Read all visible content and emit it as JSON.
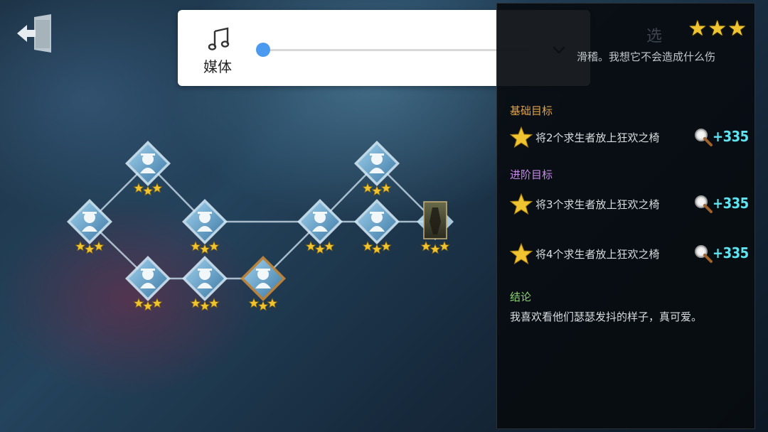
{
  "volume": {
    "label": "媒体",
    "level": 0.0,
    "music_icon": "music-note-icon",
    "expand_icon": "chevron-down-icon"
  },
  "exit_icon": "exit-door-icon",
  "side_panel": {
    "faded_title": "选",
    "top_stars": "★★★",
    "intro": "滑稽。我想它不会造成什么伤",
    "basic_title": "基础目标",
    "basic_goals": [
      {
        "text": "将2个求生者放上狂欢之椅",
        "reward": "+335"
      }
    ],
    "advanced_title": "进阶目标",
    "advanced_goals": [
      {
        "text": "将3个求生者放上狂欢之椅",
        "reward": "+335"
      },
      {
        "text": "将4个求生者放上狂欢之椅",
        "reward": "+335"
      }
    ],
    "conclusion_title": "结论",
    "conclusion": "我喜欢看他们瑟瑟发抖的样子，真可爱。",
    "colors": {
      "basic": "#e0a24a",
      "advanced": "#c58ae6",
      "conclusion": "#8ad470",
      "reward": "#5fe3f0",
      "star": "#f0c330"
    }
  },
  "map": {
    "nodes": [
      {
        "id": "n1",
        "stars": 3,
        "selected": false
      },
      {
        "id": "n2",
        "stars": 3,
        "selected": false
      },
      {
        "id": "n3",
        "stars": 3,
        "selected": false
      },
      {
        "id": "n4",
        "stars": 3,
        "selected": false
      },
      {
        "id": "n5",
        "stars": 3,
        "selected": false
      },
      {
        "id": "n6",
        "stars": 3,
        "selected": true
      },
      {
        "id": "n7",
        "stars": 3,
        "selected": false
      },
      {
        "id": "n8",
        "stars": 3,
        "selected": false
      },
      {
        "id": "n9",
        "stars": 3,
        "selected": false
      },
      {
        "id": "n10",
        "stars": 3,
        "selected": false,
        "portrait": true
      }
    ]
  }
}
